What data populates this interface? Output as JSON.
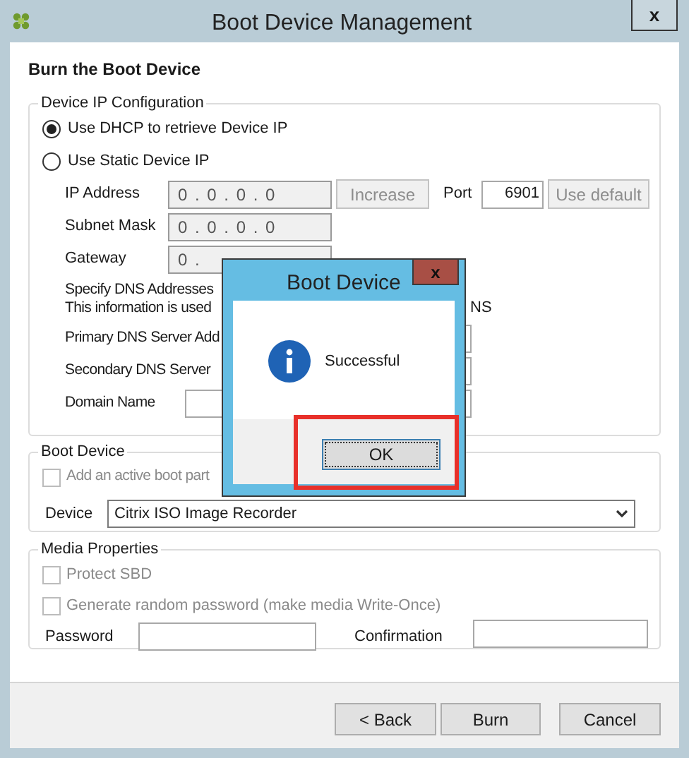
{
  "window": {
    "title": "Boot Device Management",
    "close_label": "x"
  },
  "heading": "Burn the Boot Device",
  "ip_config": {
    "title": "Device IP Configuration",
    "options": [
      {
        "label": "Use DHCP to retrieve Device IP",
        "selected": true
      },
      {
        "label": "Use Static Device IP",
        "selected": false
      }
    ],
    "ip_address": {
      "label": "IP Address",
      "value": "0 . 0 . 0 . 0",
      "disabled": true
    },
    "increase_button": {
      "label": "Increase",
      "disabled": true
    },
    "port": {
      "label": "Port",
      "value": "6901"
    },
    "use_default_button": {
      "label": "Use default",
      "disabled": true
    },
    "subnet_mask": {
      "label": "Subnet Mask",
      "value": "0 . 0 . 0 . 0",
      "disabled": true
    },
    "gateway": {
      "label": "Gateway",
      "value": "0 .",
      "disabled": true
    },
    "dns_note": {
      "lines": [
        "Specify DNS Addresses",
        "This information is used"
      ],
      "fragment": "NS"
    },
    "primary_dns": {
      "label": "Primary DNS Server Add"
    },
    "secondary_dns": {
      "label": "Secondary DNS Server"
    },
    "domain_name": {
      "label": "Domain Name"
    }
  },
  "boot_device": {
    "title": "Boot Device",
    "active_partition": {
      "label": "Add an active boot part",
      "checked": false,
      "disabled": true
    },
    "device": {
      "label": "Device",
      "value": "Citrix ISO Image Recorder"
    }
  },
  "media": {
    "title": "Media Properties",
    "options": [
      {
        "label": "Protect SBD",
        "checked": false,
        "disabled": true
      },
      {
        "label": "Generate random password (make media Write-Once)",
        "checked": false,
        "disabled": true
      }
    ],
    "password": {
      "label": "Password"
    },
    "confirmation": {
      "label": "Confirmation"
    }
  },
  "buttons": [
    {
      "label": "< Back"
    },
    {
      "label": "Burn"
    },
    {
      "label": "Cancel"
    }
  ],
  "message_box": {
    "title": "Boot Device",
    "close_label": "x",
    "message": "Successful",
    "ok_label": "OK"
  }
}
